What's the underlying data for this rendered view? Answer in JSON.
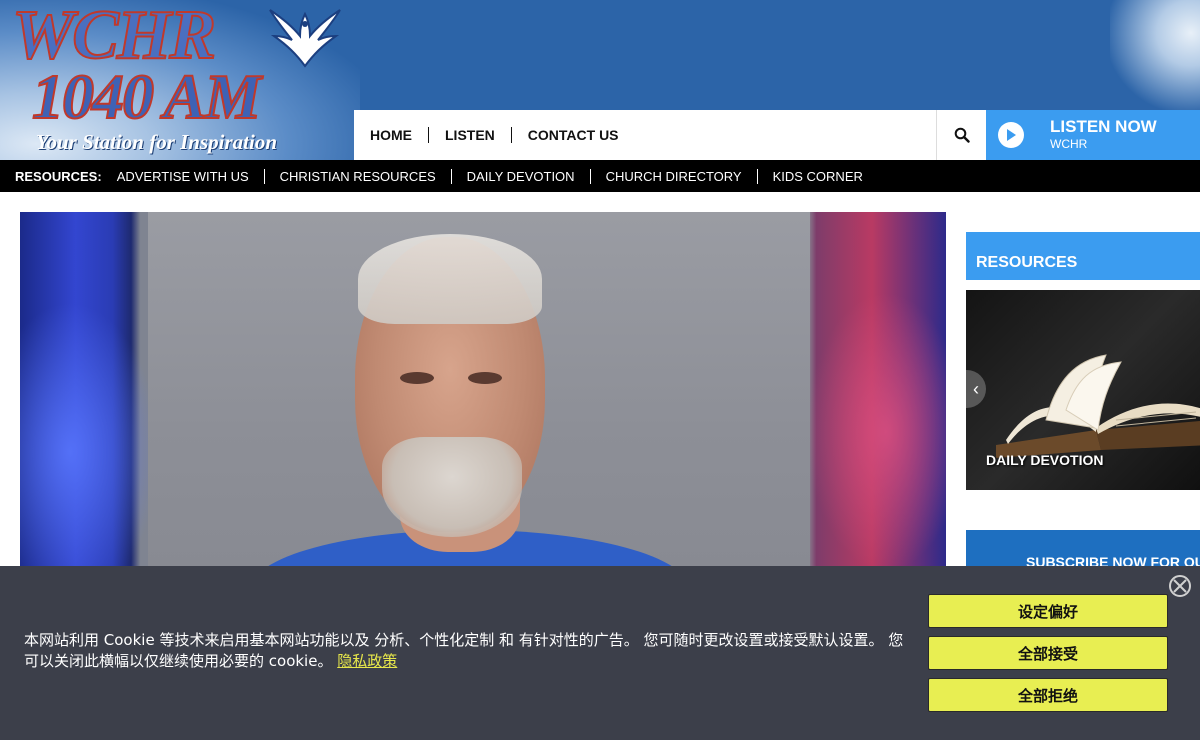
{
  "header": {
    "logo": {
      "line1": "WCHR",
      "line2": "1040 AM",
      "tagline": "Your Station for Inspiration"
    },
    "nav": [
      {
        "label": "HOME"
      },
      {
        "label": "LISTEN"
      },
      {
        "label": "CONTACT US"
      }
    ],
    "search_icon": "search-icon",
    "listen_now": {
      "title": "LISTEN NOW",
      "station": "WCHR"
    }
  },
  "resources_bar": {
    "label": "RESOURCES:",
    "links": [
      {
        "label": "ADVERTISE WITH US"
      },
      {
        "label": "CHRISTIAN RESOURCES"
      },
      {
        "label": "DAILY DEVOTION"
      },
      {
        "label": "CHURCH DIRECTORY"
      },
      {
        "label": "KIDS CORNER"
      }
    ]
  },
  "sidebar": {
    "heading": "RESOURCES",
    "card": {
      "caption": "DAILY DEVOTION",
      "prev_icon": "chevron-left-icon"
    },
    "subscribe": "SUBSCRIBE NOW FOR OUR"
  },
  "cookie_banner": {
    "message": "本网站利用 Cookie 等技术来启用基本网站功能以及 分析、个性化定制 和 有针对性的广告。 您可随时更改设置或接受默认设置。 您可以关闭此横幅以仅继续使用必要的 cookie。",
    "privacy_link": "隐私政策",
    "buttons": {
      "preferences": "设定偏好",
      "accept_all": "全部接受",
      "reject_all": "全部拒绝"
    },
    "close_icon": "close-icon"
  },
  "colors": {
    "header_blue": "#2c64a8",
    "accent_blue": "#3b9cf0",
    "banner_bg": "#3c3f4a",
    "button_yellow": "#e8ee52"
  }
}
